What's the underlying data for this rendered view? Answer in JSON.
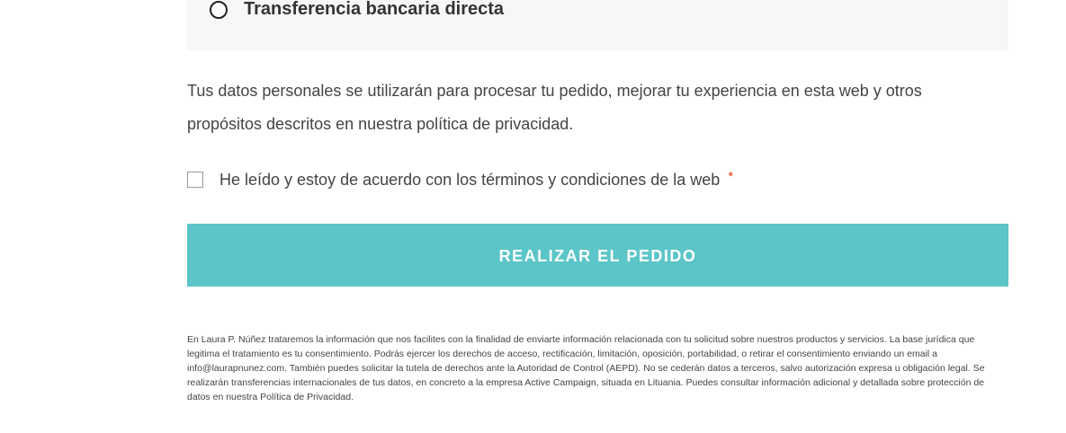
{
  "payment": {
    "option_label": "Transferencia bancaria directa"
  },
  "privacy": {
    "text": "Tus datos personales se utilizarán para procesar tu pedido, mejorar tu experiencia en esta web y otros propósitos descritos en nuestra política de privacidad."
  },
  "terms": {
    "label": "He leído y estoy de acuerdo con los términos y condiciones de la web",
    "required_mark": "*"
  },
  "order_button": {
    "label": "REALIZAR EL PEDIDO"
  },
  "legal": {
    "text": "En Laura P. Núñez trataremos la información que nos facilites con la finalidad de enviarte información relacionada con tu solicitud sobre nuestros productos y servicios. La base jurídica que legitima el tratamiento es tu consentimiento. Podrás ejercer los derechos de acceso, rectificación, limitación, oposición, portabilidad, o retirar el consentimiento enviando un email a info@laurapnunez.com. También puedes solicitar la tutela de derechos ante la Autoridad de Control (AEPD). No se cederán datos a terceros, salvo autorización expresa u obligación legal. Se realizarán transferencias internacionales de tus datos, en concreto a la empresa Active Campaign, situada en Lituania. Puedes consultar información adicional y detallada sobre protección de datos en nuestra Política de Privacidad."
  },
  "colors": {
    "button_background": "#5bc5c7",
    "payment_box_background": "#f7f7f7",
    "required_mark": "#e2401c"
  }
}
